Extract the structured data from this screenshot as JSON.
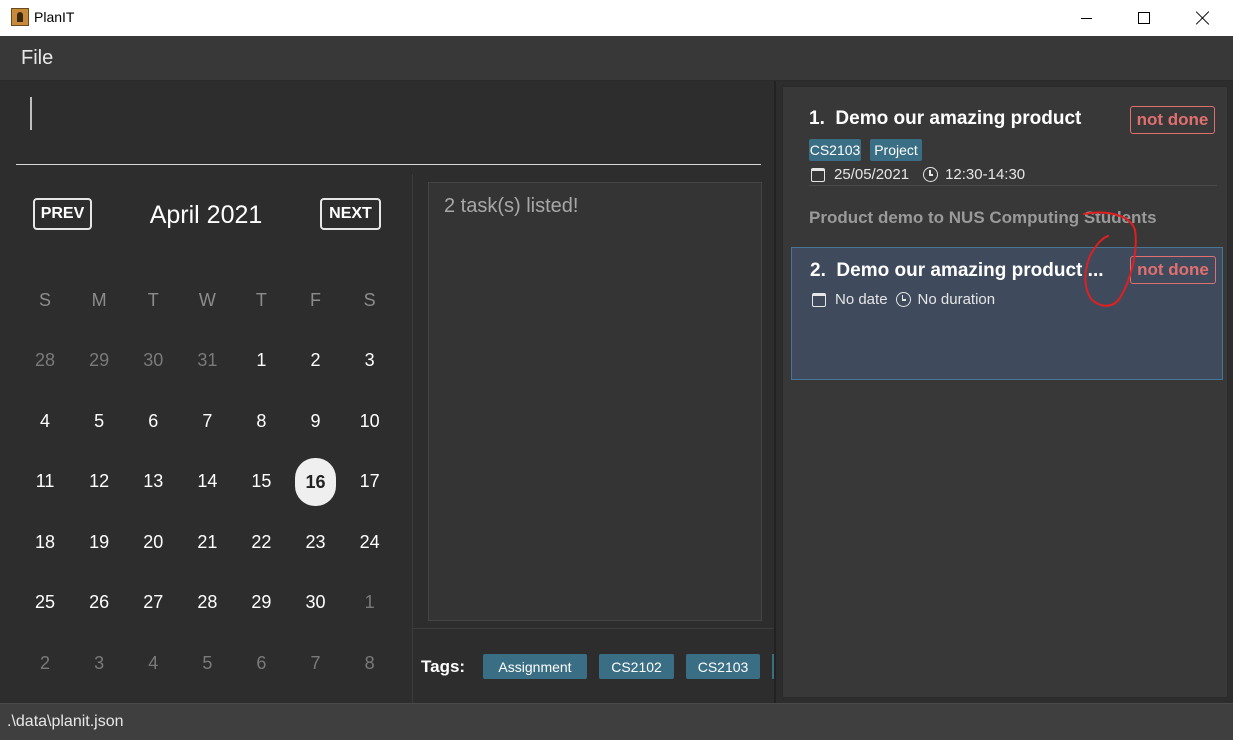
{
  "window": {
    "title": "PlanIT"
  },
  "menu": {
    "file": "File"
  },
  "calendar": {
    "prev": "PREV",
    "next": "NEXT",
    "month": "April 2021",
    "weekdays": [
      "S",
      "M",
      "T",
      "W",
      "T",
      "F",
      "S"
    ],
    "weeks": [
      [
        "28",
        "29",
        "30",
        "31",
        "1",
        "2",
        "3"
      ],
      [
        "4",
        "5",
        "6",
        "7",
        "8",
        "9",
        "10"
      ],
      [
        "11",
        "12",
        "13",
        "14",
        "15",
        "16",
        "17"
      ],
      [
        "18",
        "19",
        "20",
        "21",
        "22",
        "23",
        "24"
      ],
      [
        "25",
        "26",
        "27",
        "28",
        "29",
        "30",
        "1"
      ],
      [
        "2",
        "3",
        "4",
        "5",
        "6",
        "7",
        "8"
      ]
    ],
    "selected_day": "16"
  },
  "result": {
    "message": "2 task(s) listed!"
  },
  "tags": {
    "label": "Tags:",
    "items": [
      "Assignment",
      "CS2102",
      "CS2103"
    ]
  },
  "tasks": [
    {
      "index": "1.",
      "title": "Demo our amazing product",
      "status": "not done",
      "tags": [
        "CS2103",
        "Project"
      ],
      "date": "25/05/2021",
      "time": "12:30-14:30",
      "description": "Product demo to NUS Computing Students"
    },
    {
      "index": "2.",
      "title": "Demo our amazing product ...",
      "status": "not done",
      "date": "No date",
      "time": "No duration"
    }
  ],
  "status_bar": {
    "path": ".\\data\\planit.json"
  },
  "colors": {
    "background": "#2d2d2d",
    "tag": "#3a6e85",
    "status_not_done": "#e07070",
    "selected_card": "#3f4a5c"
  }
}
